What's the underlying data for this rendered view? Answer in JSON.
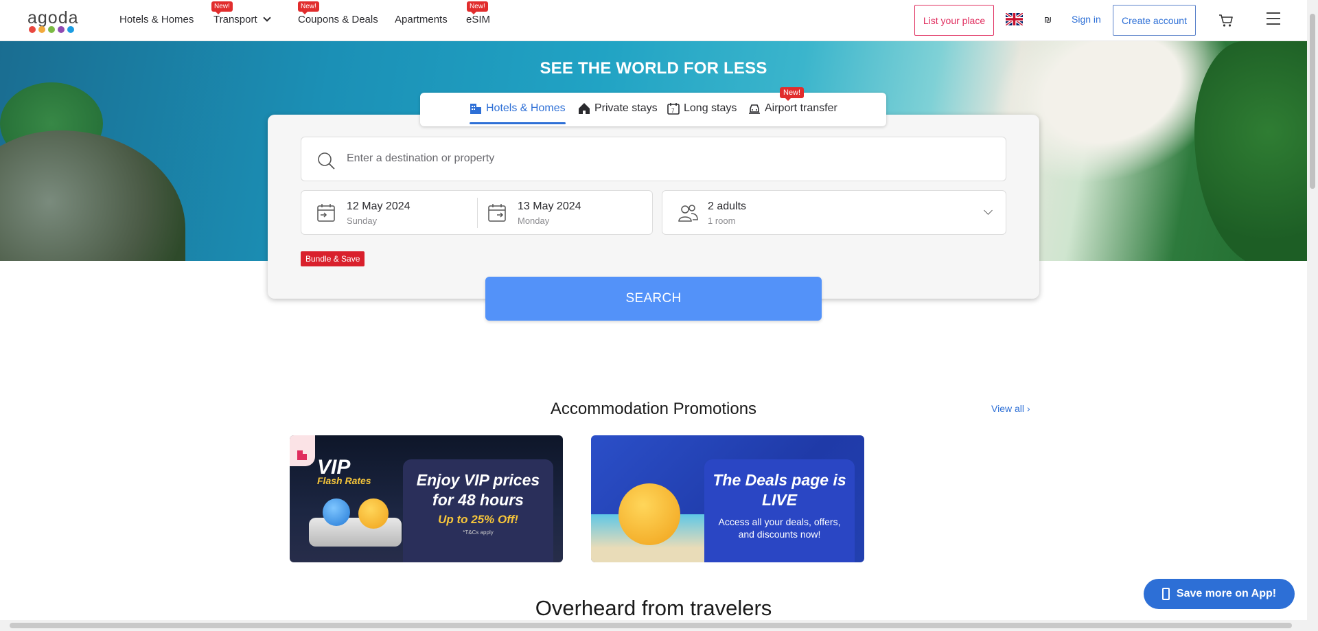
{
  "header": {
    "logo_text": "agoda",
    "logo_colors": [
      "#e9473f",
      "#f2a93b",
      "#7bba44",
      "#8f4ab2",
      "#1b9ce2"
    ],
    "nav": [
      {
        "label": "Hotels & Homes",
        "badge": ""
      },
      {
        "label": "Transport",
        "badge": "New!"
      },
      {
        "label": "Coupons & Deals",
        "badge": "New!"
      },
      {
        "label": "Apartments",
        "badge": ""
      },
      {
        "label": "eSIM",
        "badge": "New!"
      }
    ],
    "list_place": "List your place",
    "currency": "₪",
    "sign_in": "Sign in",
    "create_account": "Create account"
  },
  "hero": {
    "title": "SEE THE WORLD FOR LESS"
  },
  "search": {
    "tabs": [
      {
        "label": "Hotels & Homes",
        "icon": "hotel-icon",
        "active": true
      },
      {
        "label": "Private stays",
        "icon": "house-icon",
        "active": false
      },
      {
        "label": "Long stays",
        "icon": "calendar-7-icon",
        "active": false
      },
      {
        "label": "Airport transfer",
        "icon": "car-icon",
        "active": false
      }
    ],
    "new_badge": "New!",
    "destination_placeholder": "Enter a destination or property",
    "checkin": {
      "date": "12 May 2024",
      "day": "Sunday"
    },
    "checkout": {
      "date": "13 May 2024",
      "day": "Monday"
    },
    "guests": {
      "adults": "2 adults",
      "rooms": "1 room"
    },
    "bundle_label": "Bundle & Save",
    "search_label": "SEARCH"
  },
  "promotions": {
    "title": "Accommodation Promotions",
    "view_all": "View all ›",
    "cards": [
      {
        "logo": "VIP",
        "logo_sub": "Flash Rates",
        "headline": "Enjoy VIP prices for 48 hours",
        "sub": "Up to 25% Off!",
        "small": "*T&Cs apply"
      },
      {
        "headline": "The Deals page is LIVE",
        "text": "Access all your deals, offers, and discounts now!"
      }
    ]
  },
  "overheard_title": "Overheard from travelers",
  "app_button": "Save more on App!"
}
